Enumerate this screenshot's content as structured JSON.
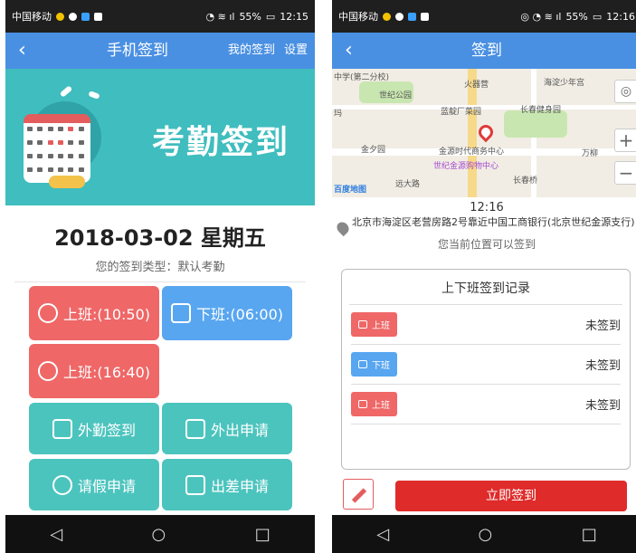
{
  "left": {
    "status": {
      "carrier": "中国移动",
      "battery": "55%",
      "time": "12:15"
    },
    "nav": {
      "back": "‹",
      "title": "手机签到",
      "my_signin": "我的签到",
      "settings": "设置"
    },
    "banner": {
      "title": "考勤签到"
    },
    "date": "2018-03-02  星期五",
    "sign_type": "您的签到类型：默认考勤",
    "buttons": {
      "on_duty_1": "上班:(10:50)",
      "off_duty": "下班:(06:00)",
      "on_duty_2": "上班:(16:40)",
      "field_signin": "外勤签到",
      "outing_apply": "外出申请",
      "leave_apply": "请假申请",
      "trip_apply": "出差申请"
    }
  },
  "right": {
    "status": {
      "carrier": "中国移动",
      "battery": "55%",
      "time": "12:16"
    },
    "nav": {
      "back": "‹",
      "title": "签到"
    },
    "map_labels": {
      "l1": "中学(第二分校)",
      "l2": "火器营",
      "l3": "海淀少年宫",
      "l4": "世纪公园",
      "l5": "蓝靛厂菜园",
      "l6": "长春健身园",
      "l7": "金夕园",
      "l8": "金源时代商务中心",
      "l9": "世纪金源购物中心",
      "l10": "长春桥",
      "l11": "万柳",
      "l12": "远大路",
      "l13": "百度地图",
      "l14": "玛"
    },
    "time": "12:16",
    "address": "北京市海淀区老营房路2号靠近中国工商银行(北京世纪金源支行)",
    "location_status": "您当前位置可以签到",
    "records": {
      "title": "上下班签到记录",
      "rows": [
        {
          "tag": "上班",
          "status": "未签到",
          "color": "#ef6767"
        },
        {
          "tag": "下班",
          "status": "未签到",
          "color": "#58a6f0"
        },
        {
          "tag": "上班",
          "status": "未签到",
          "color": "#ef6767"
        }
      ]
    },
    "signin_button": "立即签到"
  },
  "nav_keys": {
    "back": "◁",
    "home": "○",
    "recent": "□"
  }
}
